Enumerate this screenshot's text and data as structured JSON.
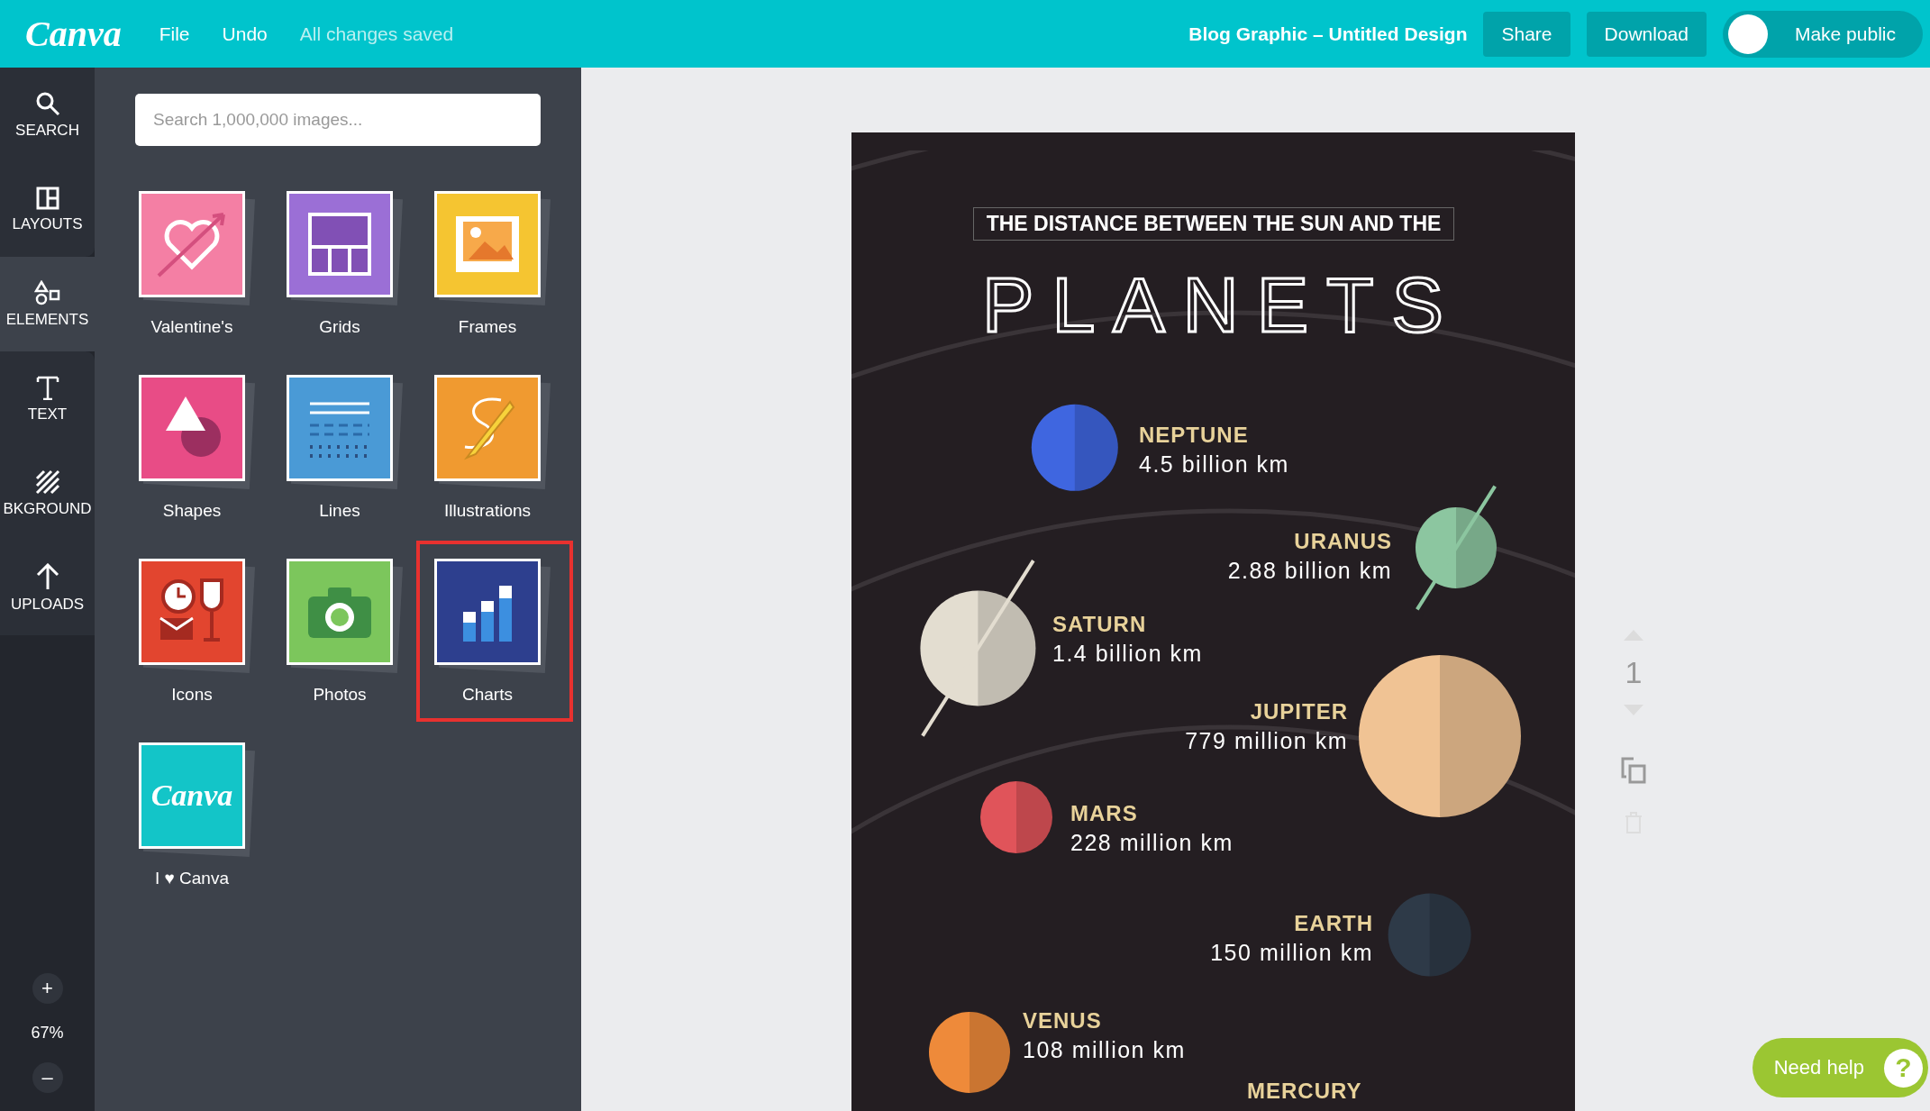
{
  "topbar": {
    "logo": "Canva",
    "menu": [
      "File",
      "Undo"
    ],
    "save_status": "All changes saved",
    "design_title": "Blog Graphic – Untitled Design",
    "buttons": [
      "Share",
      "Download"
    ],
    "public_toggle": {
      "label": "Make public",
      "on": false
    }
  },
  "rail": {
    "items": [
      {
        "label": "SEARCH",
        "selected": false
      },
      {
        "label": "LAYOUTS",
        "selected": false
      },
      {
        "label": "ELEMENTS",
        "selected": true
      },
      {
        "label": "TEXT",
        "selected": false
      },
      {
        "label": "BKGROUND",
        "selected": false
      },
      {
        "label": "UPLOADS",
        "selected": false
      }
    ],
    "zoom": {
      "plus": "+",
      "level": "67%",
      "minus": "–"
    }
  },
  "panel": {
    "search": {
      "placeholder": "Search 1,000,000 images..."
    },
    "tiles": [
      {
        "label": "Valentine's",
        "color": "#f47fa4",
        "selected": false
      },
      {
        "label": "Grids",
        "color": "#9b6fd6",
        "selected": false
      },
      {
        "label": "Frames",
        "color": "#f5c531",
        "selected": false
      },
      {
        "label": "Shapes",
        "color": "#e84c86",
        "selected": false
      },
      {
        "label": "Lines",
        "color": "#4a9ad6",
        "selected": false
      },
      {
        "label": "Illustrations",
        "color": "#f09a30",
        "selected": false
      },
      {
        "label": "Icons",
        "color": "#e2452f",
        "selected": false
      },
      {
        "label": "Photos",
        "color": "#7cc65c",
        "selected": false
      },
      {
        "label": "Charts",
        "color": "#2d3f8e",
        "selected": true
      },
      {
        "label": "I ♥ Canva",
        "color": "#13c5c8",
        "selected": false,
        "artwork_text": "Canva"
      }
    ]
  },
  "design": {
    "heading": "THE DISTANCE BETWEEN THE SUN AND THE",
    "title": "PLANETS",
    "planets": [
      {
        "name": "NEPTUNE",
        "distance": "4.5 billion km",
        "color": "#3f66e0",
        "ringed": false
      },
      {
        "name": "URANUS",
        "distance": "2.88 billion km",
        "color": "#8cc6a0",
        "ringed": true
      },
      {
        "name": "SATURN",
        "distance": "1.4 billion km",
        "color": "#e3ddd0",
        "ringed": true
      },
      {
        "name": "JUPITER",
        "distance": "779 million km",
        "color": "#f0c394",
        "ringed": false
      },
      {
        "name": "MARS",
        "distance": "228 million km",
        "color": "#e0545a",
        "ringed": false
      },
      {
        "name": "EARTH",
        "distance": "150 million km",
        "color": "#2e3a48",
        "ringed": false
      },
      {
        "name": "VENUS",
        "distance": "108 million km",
        "color": "#ee8a3a",
        "ringed": false
      },
      {
        "name": "MERCURY"
      }
    ]
  },
  "page_controls": {
    "page_number": "1"
  },
  "help": {
    "label": "Need help",
    "icon_text": "?"
  }
}
